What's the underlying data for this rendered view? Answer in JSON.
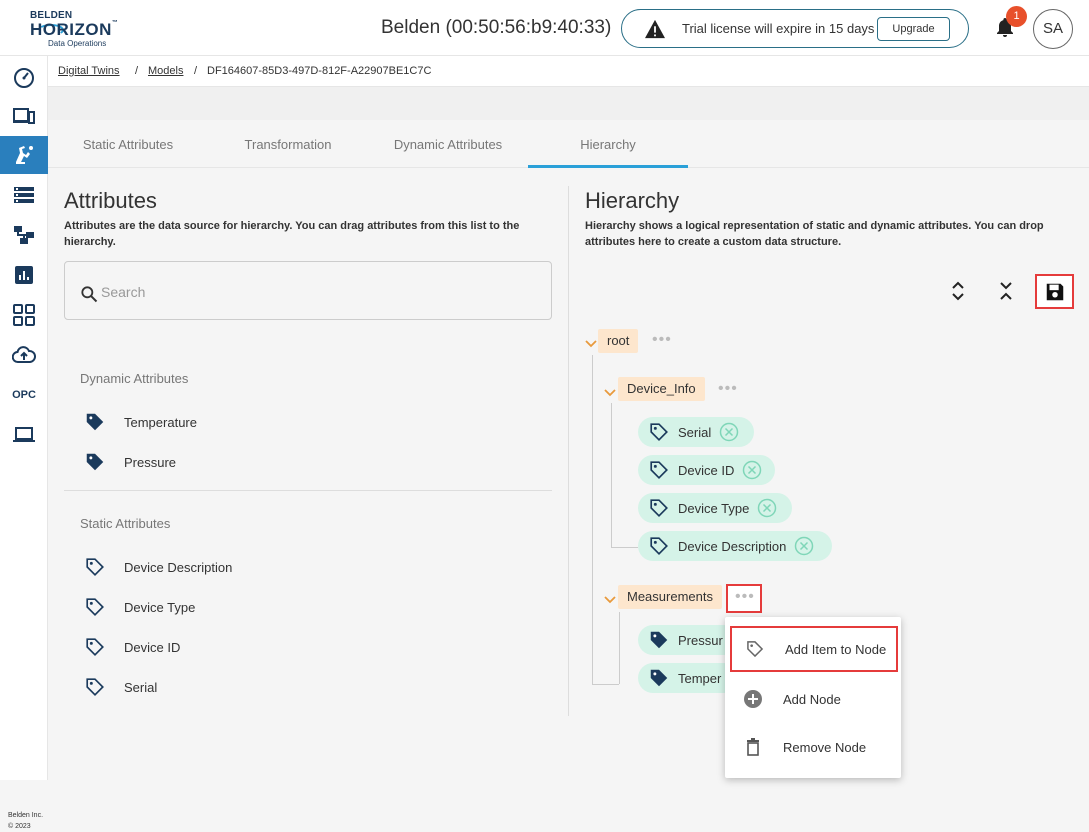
{
  "brand": {
    "line1": "BELDEN",
    "line2": "HORIZON",
    "tm": "™",
    "line3": "Data Operations"
  },
  "header": {
    "device_title": "Belden (00:50:56:b9:40:33)",
    "trial_text": "Trial license will expire in 15 days",
    "upgrade_label": "Upgrade",
    "notification_count": "1",
    "avatar_initials": "SA"
  },
  "sidebar": {
    "items": [
      {
        "icon": "dashboard-icon"
      },
      {
        "icon": "devices-icon"
      },
      {
        "icon": "digital-twin-icon",
        "active": true
      },
      {
        "icon": "list-icon"
      },
      {
        "icon": "hierarchy-icon"
      },
      {
        "icon": "report-icon"
      },
      {
        "icon": "apps-grid-icon"
      },
      {
        "icon": "cloud-upload-icon"
      },
      {
        "icon": "opc-icon",
        "label": "OPC"
      },
      {
        "icon": "laptop-icon"
      }
    ],
    "copyright_1": "Belden Inc.",
    "copyright_2": "© 2023"
  },
  "breadcrumb": {
    "item1": "Digital Twins",
    "sep": "/",
    "item2": "Models",
    "item3": "DF164607-85D3-497D-812F-A22907BE1C7C"
  },
  "tabs": [
    {
      "label": "Static Attributes"
    },
    {
      "label": "Transformation"
    },
    {
      "label": "Dynamic Attributes"
    },
    {
      "label": "Hierarchy",
      "active": true
    }
  ],
  "attributes_panel": {
    "title": "Attributes",
    "description": "Attributes are the data source for hierarchy. You can drag attributes from this list to the hierarchy.",
    "search_placeholder": "Search",
    "dynamic_title": "Dynamic Attributes",
    "dynamic_items": [
      "Temperature",
      "Pressure"
    ],
    "static_title": "Static Attributes",
    "static_items": [
      "Device Description",
      "Device Type",
      "Device ID",
      "Serial"
    ]
  },
  "hierarchy_panel": {
    "title": "Hierarchy",
    "description": "Hierarchy shows a logical representation of static and dynamic attributes. You can drop attributes here to create a custom data structure.",
    "root_label": "root",
    "node1_label": "Device_Info",
    "node1_items": [
      "Serial",
      "Device ID",
      "Device Type",
      "Device Description"
    ],
    "node2_label": "Measurements",
    "node2_items": [
      "Pressure",
      "Temperature"
    ],
    "node2_items_visible": [
      "Pressur",
      "Temper"
    ],
    "dots": "•••"
  },
  "context_menu": {
    "items": [
      "Add Item to Node",
      "Add Node",
      "Remove Node"
    ]
  },
  "colors": {
    "accent": "#2aa0d8",
    "nav_active": "#2a7fbd",
    "highlight": "#e53b3b",
    "node_bg": "#fde6cd",
    "leaf_bg": "#d5f3e8"
  }
}
